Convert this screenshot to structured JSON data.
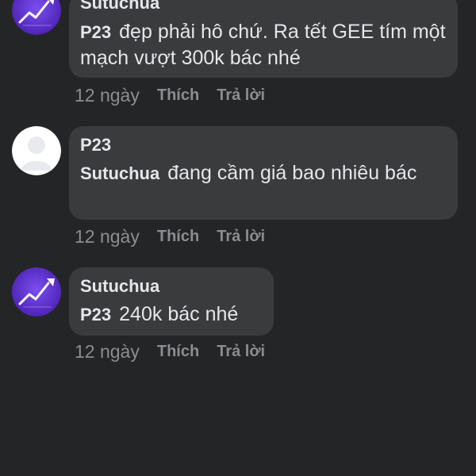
{
  "comments": [
    {
      "author": "Sutuchua",
      "mention": "P23",
      "text": "đẹp phải hô chứ. Ra tết GEE tím một mạch vượt 300k bác nhé",
      "time": "12 ngày",
      "like_label": "Thích",
      "reply_label": "Trả lời",
      "avatar": "stock-chart-logo"
    },
    {
      "author": "P23",
      "mention": "Sutuchua",
      "text": "đang cầm giá bao nhiêu bác",
      "time": "12 ngày",
      "like_label": "Thích",
      "reply_label": "Trả lời",
      "avatar": "default-profile-silhouette"
    },
    {
      "author": "Sutuchua",
      "mention": "P23",
      "text": "240k bác nhé",
      "time": "12 ngày",
      "like_label": "Thích",
      "reply_label": "Trả lời",
      "avatar": "stock-chart-logo"
    }
  ],
  "colors": {
    "background": "#242526",
    "bubble": "#3a3b3c",
    "text": "#e4e6eb",
    "meta": "#8a8d91",
    "avatar_purple": "#5a2fc8"
  }
}
